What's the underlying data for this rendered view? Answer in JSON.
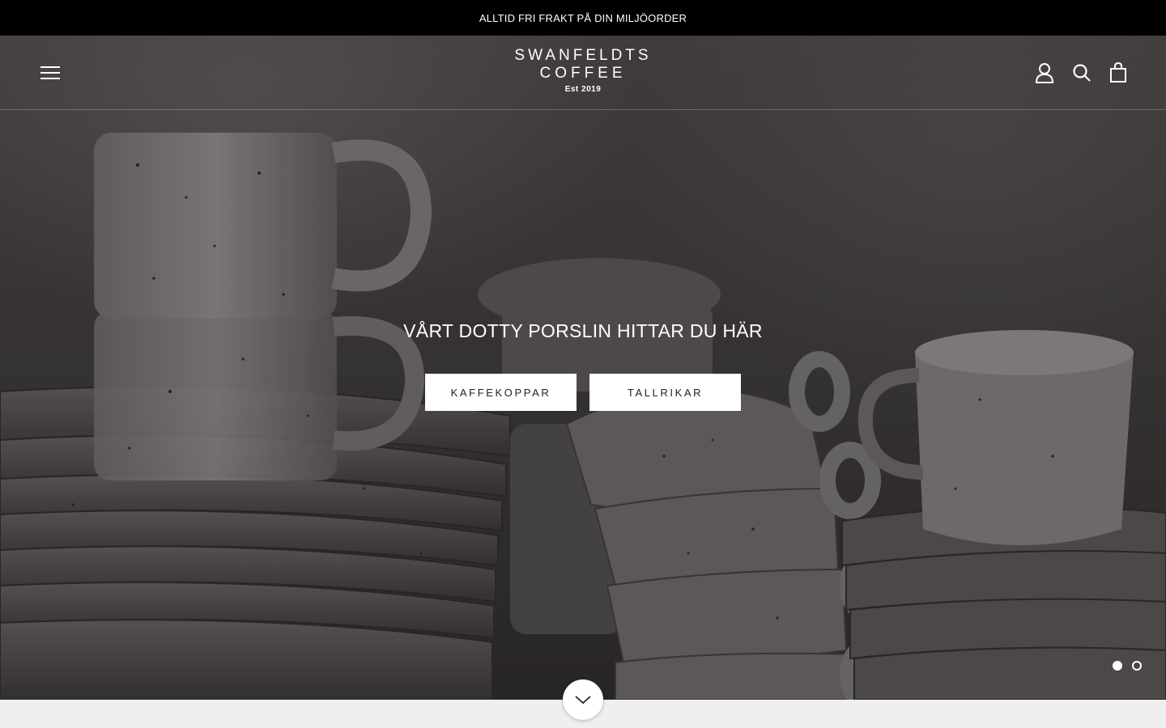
{
  "announcement": {
    "text": "ALLTID FRI FRAKT PÅ DIN MILJÖORDER"
  },
  "header": {
    "logo": {
      "line1": "SWANFELDTS",
      "line2": "COFFEE",
      "est": "Est 2019"
    },
    "icons": [
      "hamburger-menu-icon",
      "account-icon",
      "search-icon",
      "cart-bag-icon"
    ]
  },
  "hero": {
    "title": "VÅRT DOTTY PORSLIN HITTAR DU HÄR",
    "buttons": [
      {
        "label": "KAFFEKOPPAR"
      },
      {
        "label": "TALLRIKAR"
      }
    ],
    "slides": {
      "count": 2,
      "active": 1
    }
  },
  "colors": {
    "announcement_bg": "#000000",
    "button_bg": "#ffffff",
    "text_light": "#ffffff"
  }
}
